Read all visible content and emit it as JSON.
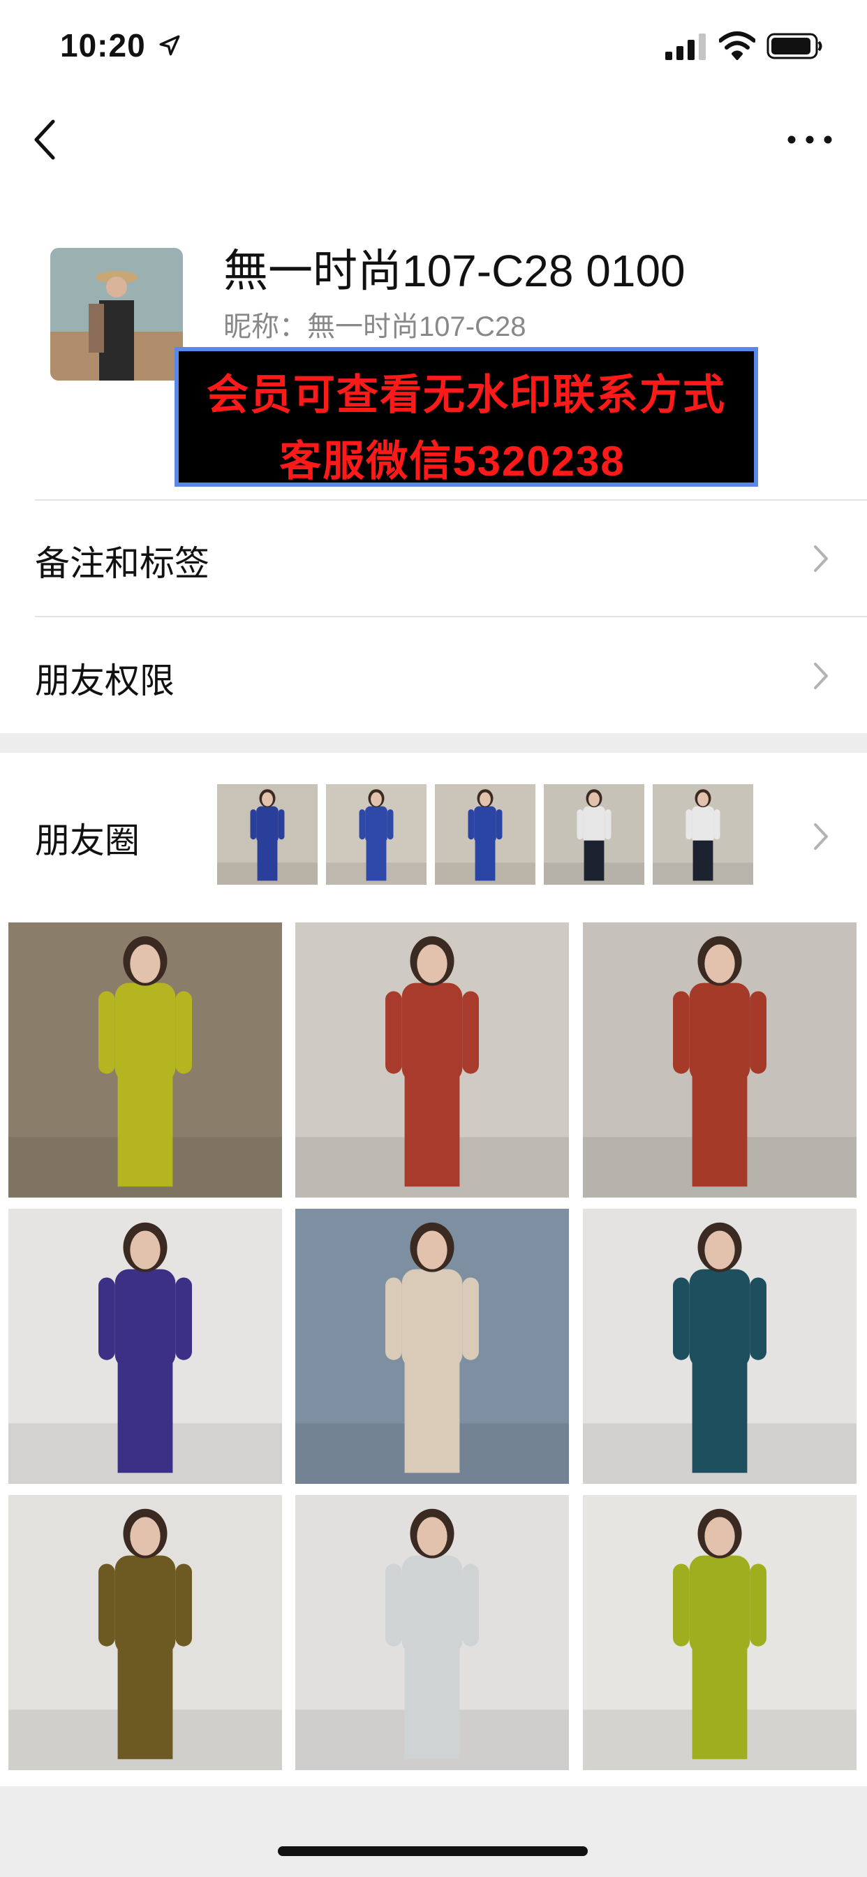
{
  "status_bar": {
    "time": "10:20"
  },
  "profile": {
    "name": "無一时尚107-C28 0100",
    "nickname": "昵称：無一时尚107-C28"
  },
  "promo": {
    "line1": "会员可查看无水印联系方式",
    "line2": "客服微信5320238"
  },
  "menu": {
    "notes_tags": "备注和标签",
    "friend_permissions": "朋友权限"
  },
  "moments": {
    "label": "朋友圈",
    "thumbnails": [
      {
        "outfit": "#2a3f9a",
        "bg": "#c9c2b6"
      },
      {
        "outfit": "#2e49a8",
        "bg": "#cfc8bd"
      },
      {
        "outfit": "#2b45a5",
        "bg": "#cbc4b8"
      },
      {
        "outfit": "#1d2230",
        "top": "#e6e6e6",
        "bg": "#c7c2b8"
      },
      {
        "outfit": "#1d2230",
        "top": "#e8e8e8",
        "bg": "#c9c4ba"
      }
    ]
  },
  "gallery": [
    {
      "outfit": "#b4b521",
      "bg": "#8a7d6a"
    },
    {
      "outfit": "#a83b2b",
      "bg": "#cfcac3"
    },
    {
      "outfit": "#a53a28",
      "bg": "#c6c2bb"
    },
    {
      "outfit": "#3b2f86",
      "bg": "#e6e4e2"
    },
    {
      "outfit": "#d9cbb8",
      "bg": "#7d8fa0"
    },
    {
      "outfit": "#1d4f5e",
      "bg": "#e4e3e1"
    },
    {
      "outfit": "#6c5a22",
      "bg": "#e2e1dd"
    },
    {
      "outfit": "#d0d3d4",
      "bg": "#e1e0de"
    },
    {
      "outfit": "#9fae1f",
      "bg": "#e6e5e2"
    }
  ],
  "colors": {
    "promo_text": "#ff1a1a",
    "promo_border": "#5b87e8",
    "page_bg": "#ededed"
  }
}
